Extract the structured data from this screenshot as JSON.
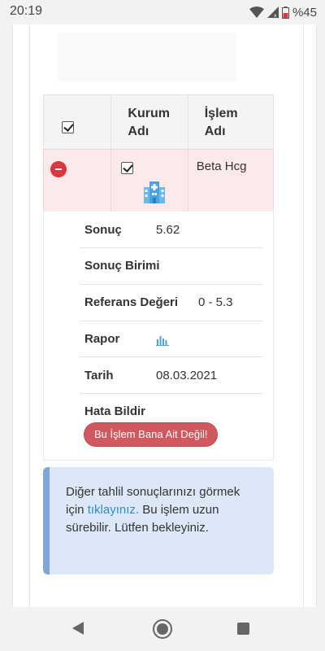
{
  "status_bar": {
    "time": "20:19",
    "battery": "%45"
  },
  "table": {
    "headers": {
      "kurum": "Kurum Adı",
      "islem": "İşlem Adı"
    },
    "row": {
      "islem_adi": "Beta Hcg"
    }
  },
  "details": {
    "sonuc_label": "Sonuç",
    "sonuc_value": "5.62",
    "birim_label": "Sonuç Birimi",
    "referans_label": "Referans Değeri",
    "referans_value": "0 - 5.3",
    "rapor_label": "Rapor",
    "tarih_label": "Tarih",
    "tarih_value": "08.03.2021",
    "hata_label": "Hata Bildir",
    "hata_button": "Bu İşlem Bana Ait Değil!"
  },
  "alert": {
    "text_before": "Diğer tahlil sonuçlarınızı görmek için ",
    "link": "tıklayınız.",
    "text_after": " Bu işlem uzun sürebilir. Lütfen bekleyiniz."
  },
  "colors": {
    "row_highlight": "#fce9ea",
    "danger": "#d9363e",
    "button": "#d0595f",
    "alert_bg": "#dce8f7",
    "link": "#2d8fd0"
  }
}
